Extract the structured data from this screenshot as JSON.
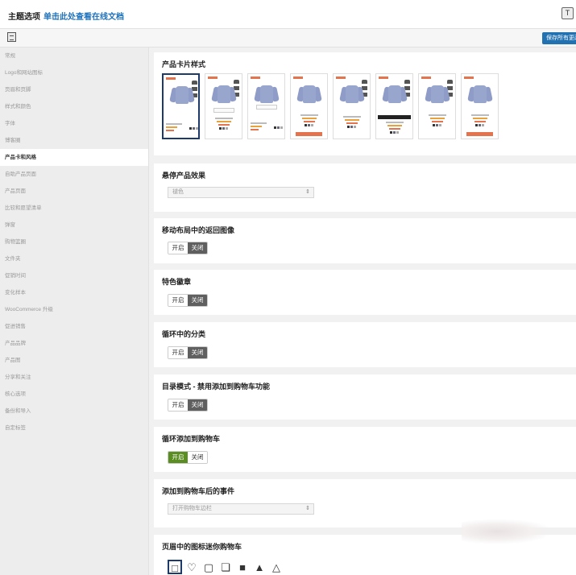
{
  "header": {
    "title": "主题选项",
    "doc_link": "单击此处查看在线文档",
    "corner_icon": "T"
  },
  "toolbar": {
    "save_label": "保存所有更改"
  },
  "sidebar": {
    "items": [
      {
        "label": "常规"
      },
      {
        "label": "Logo和网站图标"
      },
      {
        "label": "页眉和页脚"
      },
      {
        "label": "样式和颜色"
      },
      {
        "label": "字体"
      },
      {
        "label": "博客圈"
      },
      {
        "label": "产品卡和风格",
        "active": true
      },
      {
        "label": "自助产品页面"
      },
      {
        "label": "产品页面"
      },
      {
        "label": "比较和愿望清单"
      },
      {
        "label": "弹窗"
      },
      {
        "label": "购物篮圈"
      },
      {
        "label": "文件夹"
      },
      {
        "label": "促销时间"
      },
      {
        "label": "变化样本"
      },
      {
        "label": "WooCommerce 升级"
      },
      {
        "label": "促进销售"
      },
      {
        "label": "产品品牌"
      },
      {
        "label": "产品图"
      },
      {
        "label": "分享和关注"
      },
      {
        "label": "核心选项"
      },
      {
        "label": "备份和导入"
      },
      {
        "label": "自定标签"
      }
    ]
  },
  "sections": {
    "product_card": {
      "title": "产品卡片样式"
    },
    "hover": {
      "title": "悬停产品效果",
      "value": "褪色"
    },
    "mobile_back_image": {
      "title": "移动布局中的返回图像",
      "on": "开启",
      "off": "关闭"
    },
    "feature_badge": {
      "title": "特色徽章",
      "on": "开启",
      "off": "关闭"
    },
    "loop_category": {
      "title": "循环中的分类",
      "on": "开启",
      "off": "关闭"
    },
    "catalog_mode": {
      "title": "目录模式 - 禁用添加到购物车功能",
      "on": "开启",
      "off": "关闭"
    },
    "loop_add_to_cart": {
      "title": "循环添加到购物车",
      "on": "开启",
      "off": "关闭"
    },
    "after_add_event": {
      "title": "添加到购物车后的事件",
      "value": "打开购物车边栏"
    },
    "header_cart_icon": {
      "title": "页眉中的图标迷你购物车"
    }
  },
  "icons": {
    "cart_icons": [
      "bag-outline-icon",
      "bag-icon",
      "bag-light-icon",
      "cart-outline-icon",
      "cart-filled-icon",
      "basket-filled-icon",
      "basket-outline-icon"
    ]
  },
  "colors": {
    "accent": "#2271b1",
    "toggle_active_dark": "#5f5f5f",
    "toggle_active_green": "#5b8e20",
    "sale_badge": "#e3744d"
  }
}
